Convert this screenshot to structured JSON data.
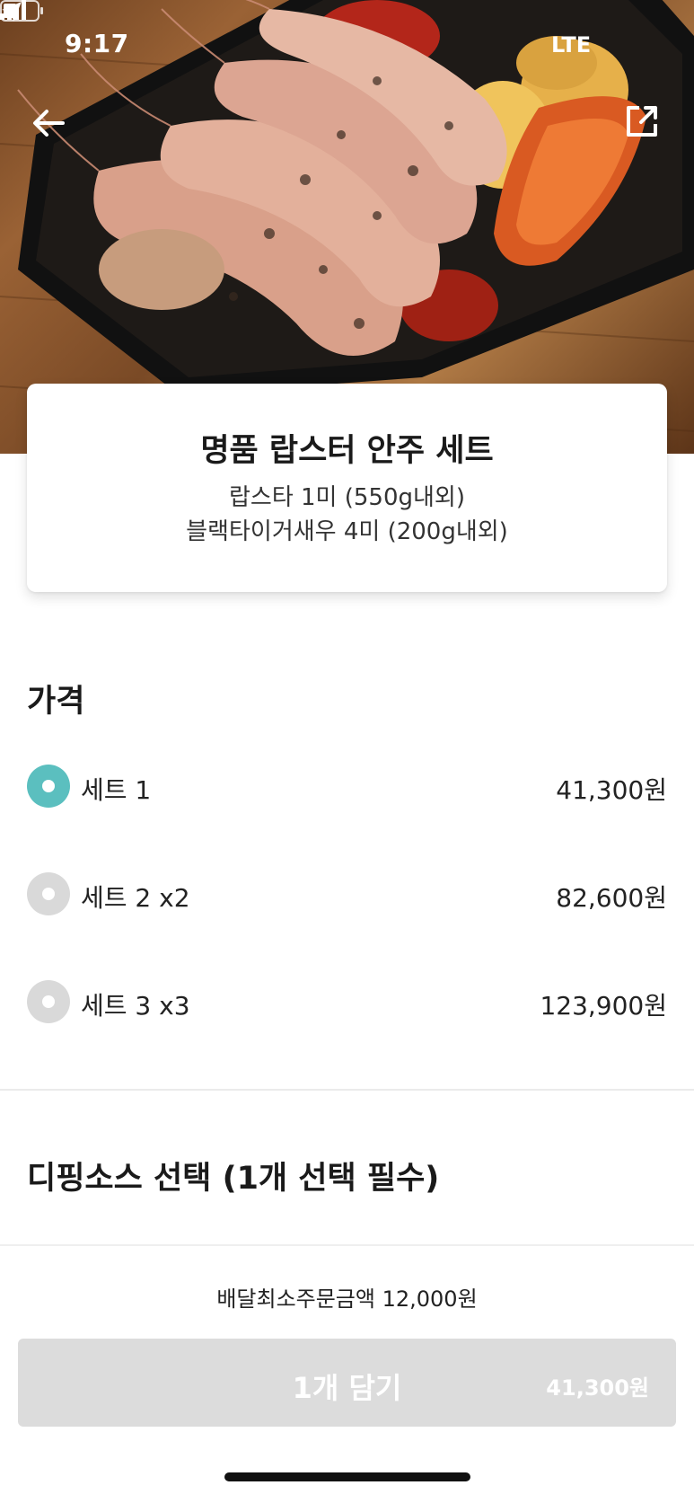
{
  "status_bar": {
    "time": "9:17",
    "network": "LTE"
  },
  "item": {
    "title": "명품 랍스터 안주 세트",
    "description_lines": [
      "랍스타 1미 (550g내외)",
      "블랙타이거새우 4미 (200g내외)"
    ]
  },
  "price_section": {
    "heading": "가격",
    "options": [
      {
        "label": "세트 1",
        "price": "41,300원",
        "selected": true
      },
      {
        "label": "세트 2 x2",
        "price": "82,600원",
        "selected": false
      },
      {
        "label": "세트 3 x3",
        "price": "123,900원",
        "selected": false
      }
    ]
  },
  "sauce_section": {
    "heading": "디핑소스 선택 (1개 선택 필수)"
  },
  "bottom_bar": {
    "min_order": "배달최소주문금액 12,000원",
    "add_button_label": "1개 담기",
    "add_button_price": "41,300원"
  },
  "colors": {
    "accent": "#5bbfbf",
    "disabled_button": "#dcdcdc"
  },
  "icons": [
    "back-arrow-icon",
    "share-icon",
    "location-arrow-icon",
    "signal-icon",
    "battery-icon"
  ]
}
